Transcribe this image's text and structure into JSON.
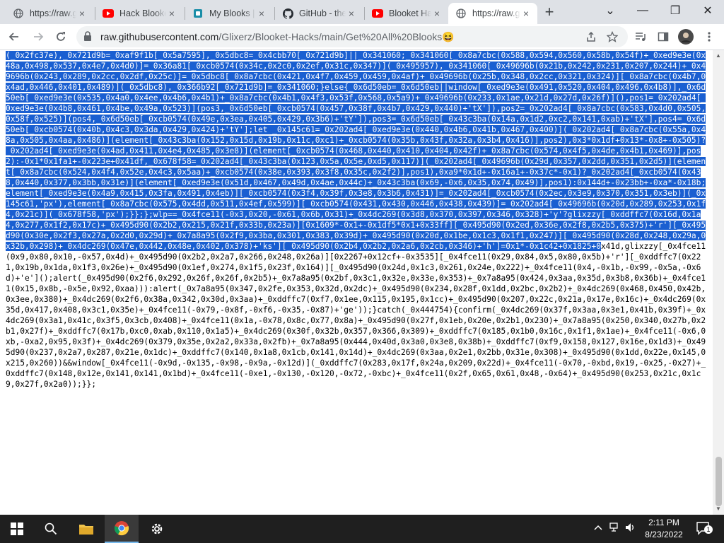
{
  "tabs": [
    {
      "title": "https://raw.githubusercontent.com",
      "favicon": "globe-icon",
      "close": "×"
    },
    {
      "title": "Hack Blooket",
      "favicon": "youtube-icon",
      "close": "×"
    },
    {
      "title": "My Blooks | Blooket",
      "favicon": "blooket-icon",
      "close": "×"
    },
    {
      "title": "GitHub - the",
      "favicon": "github-icon",
      "close": "×"
    },
    {
      "title": "Blooket Hacks",
      "favicon": "youtube-icon",
      "close": "×"
    },
    {
      "title": "https://raw.githubusercontent.com",
      "favicon": "globe-icon",
      "close": "×"
    }
  ],
  "new_tab": "+",
  "window_controls": {
    "minimize": "—",
    "maximize": "❐",
    "close": "✕",
    "tab_search": "⌄"
  },
  "address_bar": {
    "domain": "raw.githubusercontent.com",
    "path": "/Glixerz/Blooket-Hacks/main/Get%20All%20Blooks",
    "emoji": "😆"
  },
  "code": {
    "selected": "(_0x2fc37e),_0x721d9b=_0xaf9f1b[_0x5a7595],_0x5dbc8=_0x4cbb70[_0x721d9b]||_0x341060;_0x341060[_0x8a7cbc(0x588,0x594,0x560,0x58b,0x54f)+_0xed9e3e(0x48a,0x498,0x537,0x4e7,0x4d0)]=_0x36a81[_0xcb0574(0x34c,0x2c0,0x2ef,0x31c,0x347)](_0x495957),_0x341060[_0x49696b(0x21b,0x242,0x231,0x207,0x244)+_0x49696b(0x243,0x289,0x2cc,0x2df,0x25c)]=_0x5dbc8[_0x8a7cbc(0x421,0x4f7,0x459,0x459,0x4af)+_0x49696b(0x25b,0x348,0x2cc,0x321,0x324)][_0x8a7cbc(0x4b7,0x4ad,0x446,0x401,0x489)](_0x5dbc8),_0x366b92[_0x721d9b]=_0x341060;}else{_0x6d50eb=_0x6d50eb||window[_0xed9e3e(0x491,0x520,0x404,0x496,0x4b8)],_0x6d50eb[_0xed9e3e(0x535,0x4a0,0x4ee,0x4b6,0x4b1)+_0x8a7cbc(0x4b1,0x4f3,0x53f,0x568,0x5a9)+_0x49696b(0x233,0x1ae,0x21d,0x27d,0x26f)](),pos1=_0x202ad4[_0xed9e3e(0x4b8,0x461,0x4be,0x49a,0x523)](pos3,_0x6d50eb[_0xcb0574(0x457,0x38f,0x4b7,0x429,0x440)+'tX']),pos2=_0x202ad4[_0x8a7cbc(0x583,0x4d0,0x505,0x58f,0x525)](pos4,_0x6d50eb[_0xcb0574(0x49e,0x3ea,0x405,0x429,0x3b6)+'tY']),pos3=_0x6d50eb[_0x43c3ba(0x14a,0x1d2,0xc2,0x141,0xab)+'tX'],pos4=_0x6d50eb[_0xcb0574(0x40b,0x4c3,0x3da,0x429,0x424)+'tY'];let _0x145c61=_0x202ad4[_0xed9e3e(0x440,0x4b6,0x41b,0x467,0x400)](_0x202ad4[_0x8a7cbc(0x55a,0x48a,0x505,0x4aa,0x486)](element[_0x43c3ba(0x152,0x15d,0x19b,0x11c,0xc1)+_0xcb0574(0x35b,0x43f,0x32a,0x3b4,0x416)],pos2),0x3*0x1df+0x13*-0x8+-0x505)?_0x202ad4[_0xed9e3e(0x4ad,0x411,0x4e4,0x485,0x3e8)](element[_0xcb0574(0x468,0x440,0x410,0x404,0x42f)+_0x8a7cbc(0x574,0x4f5,0x4de,0x4b1,0x469)],pos2):-0x1*0x1fa1+-0x223e+0x41df,_0x678f58=_0x202ad4[_0x43c3ba(0x123,0x5a,0x5e,0xd5,0x117)](_0x202ad4[_0x49696b(0x29d,0x357,0x2dd,0x351,0x2d5)](element[_0x8a7cbc(0x524,0x4f4,0x52e,0x4c3,0x5aa)+_0xcb0574(0x38e,0x393,0x3f8,0x35c,0x2f2)],pos1),0xa9*0x1d+-0x16a1+-0x37c*-0x1)?_0x202ad4[_0xcb0574(0x438,0x440,0x377,0x3bb,0x31e)](element[_0xed9e3e(0x51d,0x467,0x49d,0x4ae,0x44c)+_0x43c3ba(0x69,-0x6,0x35,0x74,0x49)],pos1):0x144d+-0x23bb+-0xa*-0x18b;element[_0xed9e3e(0x4a9,0x415,0x3fa,0x491,0x4eb)][_0xcb0574(0x3f4,0x39f,0x3e8,0x3b6,0x431)]=_0x202ad4[_0xcb0574(0x2ec,0x3e9,0x370,0x351,0x3eb)](_0x145c61,'px'),element[_0x8a7cbc(0x575,0x4dd,0x511,0x4ef,0x599)][_0xcb0574(0x431,0x430,0x446,0x438,0x439)]=_0x202ad4[_0x49696b(0x20d,0x289,0x253,0x1f4,0x21c)](_0x678f58,'px');}};};wlp==_0x4fce11(-0x3,0x20,-0x61,0x6b,0x31)+_0x4dc269(0x3d8,0x370,0x397,0x346,0x328)+'y'?glixzzy[_0xddffc7(0x16d,0x1a4,0x277,0x1f2,0x17c)+_0x495d90(0x2b2,0x215,0x21f,0x33b,0x23a)][0x1609*-0x1+-0x1df5*0x1+0x33ff][_0x495d90(0x2ed,0x36e,0x2f8,0x2b5,0x375)+'r'][_0x495d90(0x30e,0x2f3,0x27a,0x2d0,0x29d)+_0x7a8a95(0x2f9,0x3ba,0x301,0x383,0x39d)+_0x495d90(0x20d,0x1be,0x1c3,0x1f1,0x247)][_0x495d90(0x28d,0x248,0x29a,0x32b,0x298)+_0x4dc269(0x47e,0x442,0x48e,0x402,0x378)+'ks'][_0x495d90(0x2b4,0x2b2,0x2a6,0x2cb,0x346)+'h']=0x1*-0x1c42+0x1825+0",
    "unselected": "x41d,glixzzy[_0x4fce11(0x9,0x80,0x10,-0x57,0x4d)+_0x495d90(0x2b2,0x2a7,0x266,0x248,0x26a)][0x2267+0x12cf+-0x3535][_0x4fce11(0x29,0x84,0x5,0x80,0x5b)+'r'][_0xddffc7(0x221,0x19b,0x1da,0x1f3,0x26e)+_0x495d90(0x1ef,0x274,0x1f5,0x23f,0x164)][_0x495d90(0x24d,0x1c3,0x261,0x24e,0x222)+_0x4fce11(0x4,-0x1b,-0x99,-0x5a,-0x6d)+'e']();alert(_0x495d90(0x2f6,0x292,0x26f,0x26f,0x2b5)+_0x7a8a95(0x2bf,0x3c1,0x32e,0x33e,0x353)+_0x7a8a95(0x424,0x3aa,0x35d,0x3b8,0x36b)+_0x4fce11(0x15,0x8b,-0x5e,0x92,0xaa))):alert(_0x7a8a95(0x347,0x2fe,0x353,0x32d,0x2dc)+_0x495d90(0x234,0x28f,0x1dd,0x2bc,0x2b2)+_0x4dc269(0x468,0x450,0x42b,0x3ee,0x380)+_0x4dc269(0x2f6,0x38a,0x342,0x30d,0x3aa)+_0xddffc7(0xf7,0x1ee,0x115,0x195,0x1cc)+_0x495d90(0x207,0x22c,0x21a,0x17e,0x16c)+_0x4dc269(0x35d,0x417,0x408,0x3c1,0x35e)+_0x4fce11(-0x79,-0x8f,-0xf6,-0x35,-0x87)+'ge'));}catch(_0x444754){confirm(_0x4dc269(0x37f,0x3aa,0x3e1,0x41b,0x39f)+_0x4dc269(0x3a1,0x41c,0x3f5,0x3cb,0x408)+_0x4fce11(0x1a,-0x78,0x8c,0x77,0x8a)+_0x495d90(0x27f,0x1eb,0x20e,0x2b1,0x230)+_0x7a8a95(0x250,0x340,0x27b,0x2b1,0x27f)+_0xddffc7(0x17b,0xc0,0xab,0x110,0x1a5)+_0x4dc269(0x30f,0x32b,0x357,0x366,0x309)+_0xddffc7(0x185,0x1b0,0x16c,0x1f1,0x1ae)+_0x4fce11(-0x6,0xb,-0xa2,0x95,0x3f)+_0x4dc269(0x379,0x35e,0x2a2,0x33a,0x2fb)+_0x7a8a95(0x444,0x40d,0x3a0,0x3e8,0x38b)+_0xddffc7(0xf9,0x158,0x127,0x16e,0x1d3)+_0x495d90(0x237,0x2a7,0x287,0x21e,0x1dc)+_0xddffc7(0x140,0x1a8,0x1cb,0x141,0x14d)+_0x4dc269(0x3aa,0x2e1,0x2bb,0x31e,0x308)+_0x495d90(0x1dd,0x22e,0x145,0x215,0x260))&&window[_0x4fce11(-0x9d,-0x135,-0x98,-0x9a,-0x12d)](_0xddffc7(0x283,0x17f,0x24a,0x209,0x22d)+_0x4fce11(-0x70,-0xbd,0x19,-0x25,-0x27)+_0xddffc7(0x148,0x12e,0x141,0x141,0x1bd)+_0x4fce11(-0xe1,-0x130,-0x120,-0x72,-0xbc)+_0x4fce11(0x2f,0x65,0x61,0x48,-0x64)+_0x495d90(0x253,0x21c,0x1c9,0x27f,0x2a0));}};"
  },
  "taskbar": {
    "time": "2:11 PM",
    "date": "8/23/2022",
    "notification_count": "1"
  },
  "colors": {
    "selection": "#1a5fd1",
    "youtube": "#ff0000",
    "taskbar": "#1f1f1f"
  }
}
